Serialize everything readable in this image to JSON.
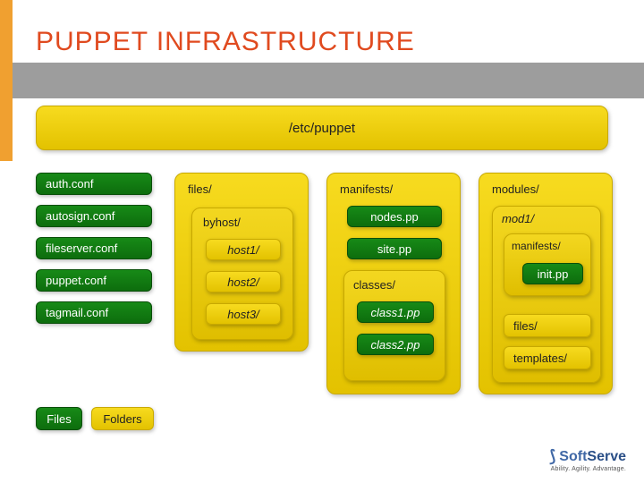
{
  "title": "PUPPET INFRASTRUCTURE",
  "root_folder": "/etc/puppet",
  "conf_files": [
    "auth.conf",
    "autosign.conf",
    "fileserver.conf",
    "puppet.conf",
    "tagmail.conf"
  ],
  "files_col": {
    "label": "files/",
    "byhost_label": "byhost/",
    "hosts": [
      "host1/",
      "host2/",
      "host3/"
    ]
  },
  "manifests_col": {
    "label": "manifests/",
    "nodes": "nodes.pp",
    "site": "site.pp",
    "classes_label": "classes/",
    "classes": [
      "class1.pp",
      "class2.pp"
    ]
  },
  "modules_col": {
    "label": "modules/",
    "mod_label": "mod1/",
    "manifests_label": "manifests/",
    "init": "init.pp",
    "files_label": "files/",
    "templates_label": "templates/"
  },
  "legend": {
    "files": "Files",
    "folders": "Folders"
  },
  "logo": {
    "brand_a": "Soft",
    "brand_b": "Serve",
    "tag": "Ability. Agility. Advantage."
  }
}
